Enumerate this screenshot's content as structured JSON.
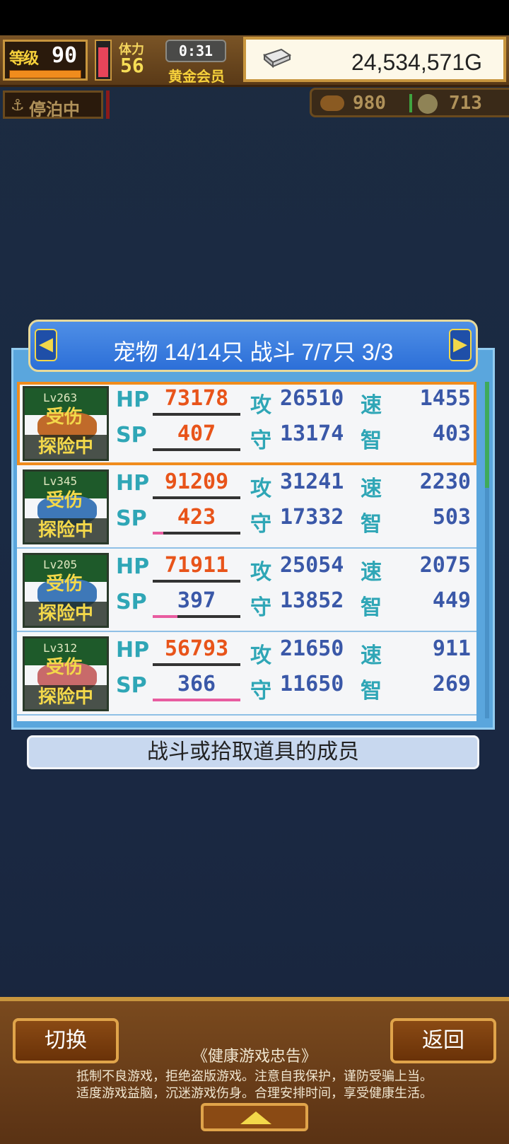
{
  "hud": {
    "level_label": "等级",
    "level_value": "90",
    "stamina_label": "体力",
    "stamina_value": "56",
    "timer": "0:31",
    "membership": "黄金会员",
    "gold": "24,534,571G",
    "status_label": "停泊中",
    "resource1": "980",
    "resource2": "713"
  },
  "header": {
    "title": "宠物 14/14只 战斗 7/7只  3/3",
    "left_arrow": "◀",
    "right_arrow": "▶"
  },
  "pets": [
    {
      "level": "Lv263",
      "injury": "受伤",
      "status": "探险中",
      "hp": "73178",
      "sp": "407",
      "sp_fill": 0,
      "atk": "26510",
      "spd": "1455",
      "def": "13174",
      "int": "403",
      "selected": true
    },
    {
      "level": "Lv345",
      "injury": "受伤",
      "status": "探险中",
      "hp": "91209",
      "sp": "423",
      "sp_fill": 0.12,
      "atk": "31241",
      "spd": "2230",
      "def": "17332",
      "int": "503",
      "selected": false
    },
    {
      "level": "Lv205",
      "injury": "受伤",
      "status": "探险中",
      "hp": "71911",
      "sp": "397",
      "sp_fill": 0.28,
      "atk": "25054",
      "spd": "2075",
      "def": "13852",
      "int": "449",
      "selected": false
    },
    {
      "level": "Lv312",
      "injury": "受伤",
      "status": "探险中",
      "hp": "56793",
      "sp": "366",
      "sp_fill": 1.0,
      "atk": "21650",
      "spd": "911",
      "def": "11650",
      "int": "269",
      "selected": false
    }
  ],
  "labels": {
    "hp": "HP",
    "sp": "SP",
    "atk": "攻",
    "def": "守",
    "spd": "速",
    "int": "智"
  },
  "info_text": "战斗或拾取道具的成员",
  "bottom": {
    "switch_label": "切换",
    "back_label": "返回",
    "notice_title": "《健康游戏忠告》",
    "notice_line1": "抵制不良游戏，拒绝盗版游戏。注意自我保护，谨防受骗上当。",
    "notice_line2": "适度游戏益脑，沉迷游戏伤身。合理安排时间，享受健康生活。"
  },
  "colors": {
    "accent_orange": "#f08c1d",
    "panel_blue": "#5aa6dd",
    "header_blue": "#2c6fd8",
    "wood": "#7a4a1e"
  }
}
